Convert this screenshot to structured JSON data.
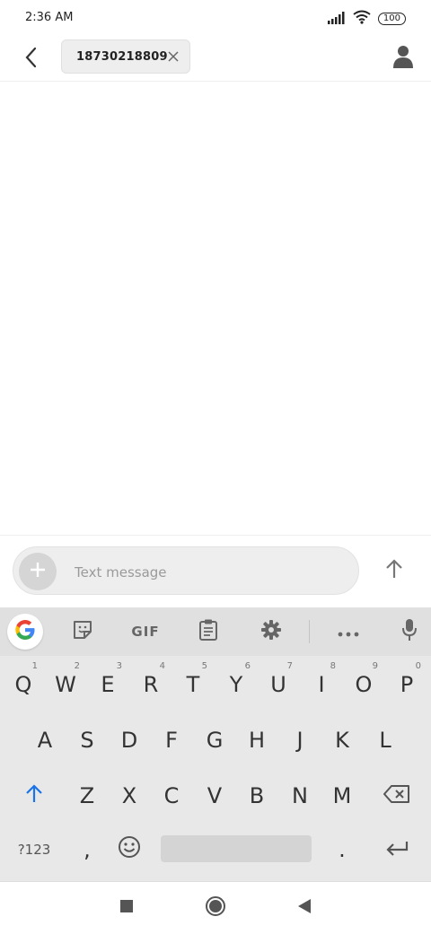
{
  "status_bar": {
    "time": "2:36 AM",
    "battery": "100"
  },
  "header": {
    "recipient": "18730218809"
  },
  "composer": {
    "placeholder": "Text message"
  },
  "keyboard": {
    "toolbar": {
      "gif_label": "GIF"
    },
    "row1": [
      {
        "label": "Q",
        "hint": "1"
      },
      {
        "label": "W",
        "hint": "2"
      },
      {
        "label": "E",
        "hint": "3"
      },
      {
        "label": "R",
        "hint": "4"
      },
      {
        "label": "T",
        "hint": "5"
      },
      {
        "label": "Y",
        "hint": "6"
      },
      {
        "label": "U",
        "hint": "7"
      },
      {
        "label": "I",
        "hint": "8"
      },
      {
        "label": "O",
        "hint": "9"
      },
      {
        "label": "P",
        "hint": "0"
      }
    ],
    "row2": [
      "A",
      "S",
      "D",
      "F",
      "G",
      "H",
      "J",
      "K",
      "L"
    ],
    "row3": [
      "Z",
      "X",
      "C",
      "V",
      "B",
      "N",
      "M"
    ],
    "symbols_key": "?123",
    "comma_key": ",",
    "period_key": "."
  },
  "colors": {
    "accent_blue": "#1a73e8",
    "keyboard_bg": "#e8e8e8",
    "toolbar_bg": "#e0e0e0"
  }
}
